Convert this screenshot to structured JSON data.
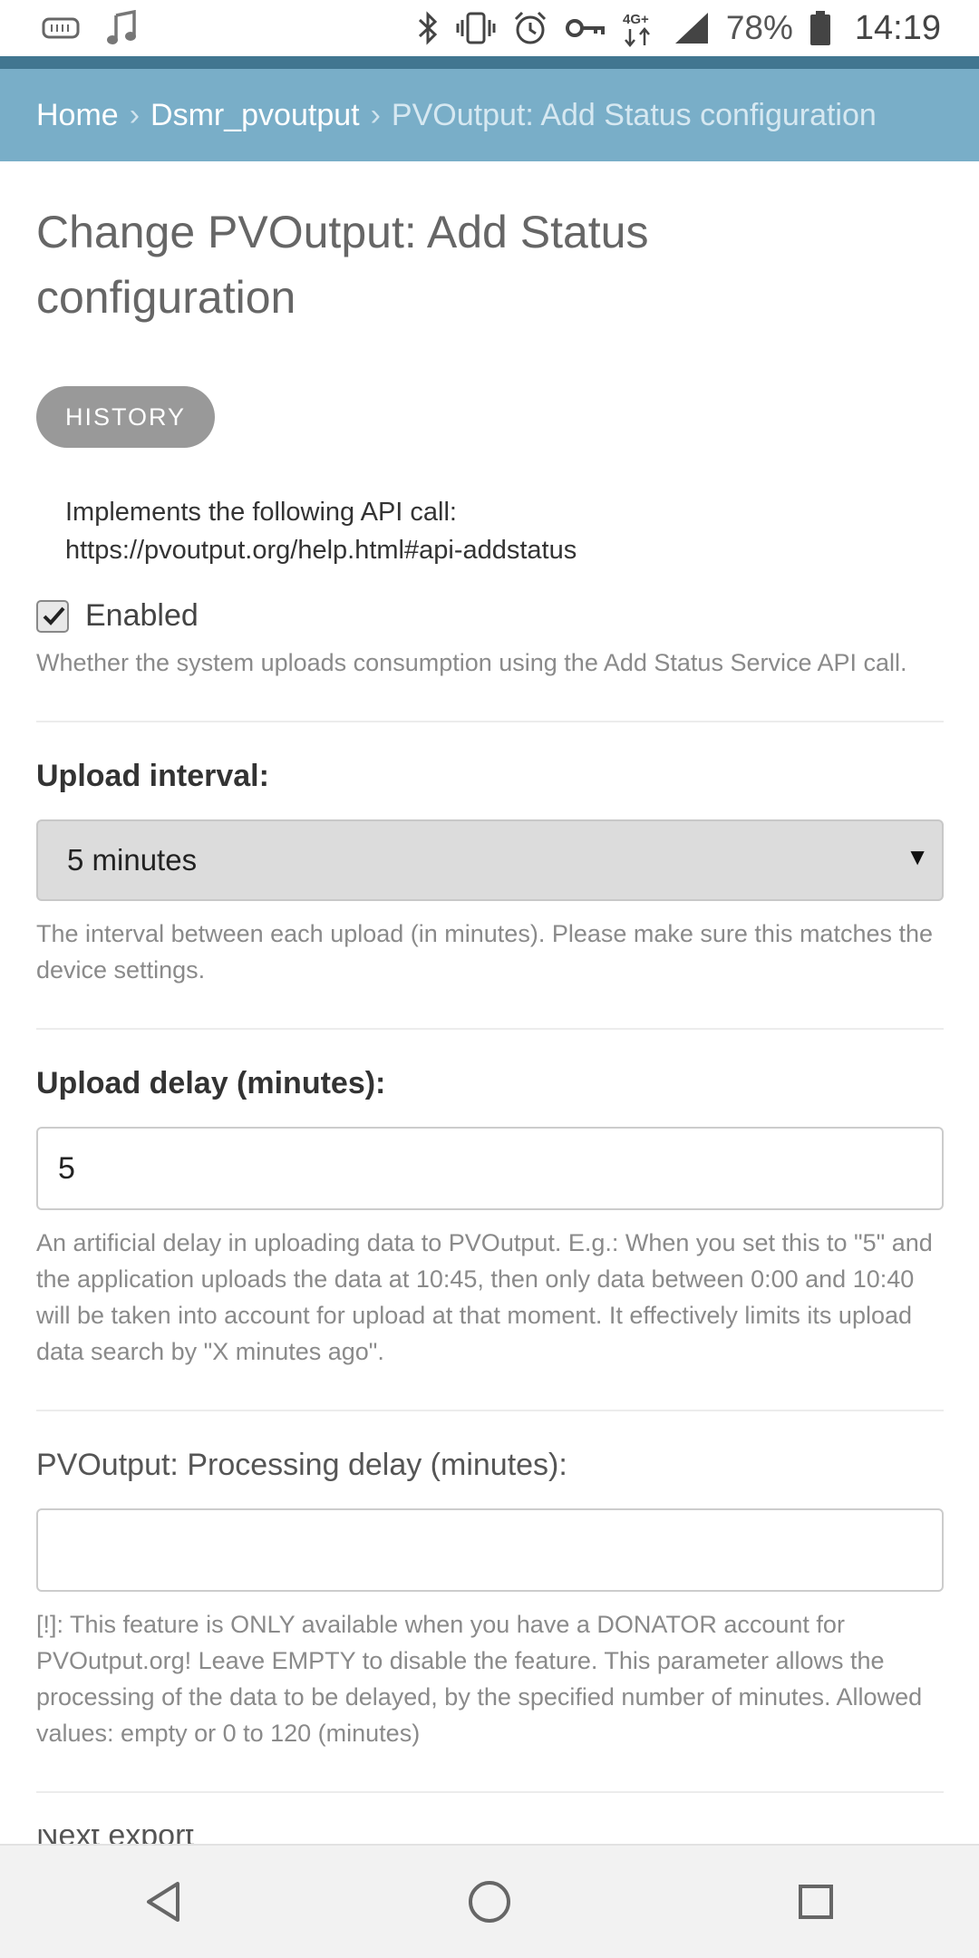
{
  "status_bar": {
    "time": "14:19",
    "battery_percent": "78%",
    "network": "4G+",
    "icons": [
      "sd-card-icon",
      "music-note-icon",
      "bluetooth-icon",
      "vibrate-icon",
      "alarm-icon",
      "key-icon",
      "network-icon",
      "signal-icon",
      "battery-icon"
    ]
  },
  "breadcrumbs": {
    "home": "Home",
    "separator": "›",
    "app": "Dsmr_pvoutput",
    "current": "PVOutput: Add Status configuration"
  },
  "page": {
    "title": "Change PVOutput: Add Status configuration",
    "history_button": "HISTORY",
    "description_line1": "Implements the following API call:",
    "description_line2": "https://pvoutput.org/help.html#api-addstatus"
  },
  "fields": {
    "enabled": {
      "label": "Enabled",
      "checked": true,
      "help": "Whether the system uploads consumption using the Add Status Service API call."
    },
    "upload_interval": {
      "label": "Upload interval:",
      "value": "5 minutes",
      "arrow": "▼",
      "help": "The interval between each upload (in minutes). Please make sure this matches the device settings."
    },
    "upload_delay": {
      "label": "Upload delay (minutes):",
      "value": "5",
      "help": "An artificial delay in uploading data to PVOutput. E.g.: When you set this to \"5\" and the application uploads the data at 10:45, then only data between 0:00 and 10:40 will be taken into account for upload at that moment. It effectively limits its upload data search by \"X minutes ago\"."
    },
    "processing_delay": {
      "label": "PVOutput: Processing delay (minutes):",
      "value": "",
      "help": "[!]: This feature is ONLY available when you have a DONATOR account for PVOutput.org! Leave EMPTY to disable the feature. This parameter allows the processing of the data to be delayed, by the specified number of minutes. Allowed values: empty or 0 to 120 (minutes)"
    },
    "next_field_label": "Next export"
  },
  "colors": {
    "header_dark": "#417690",
    "breadcrumb_bg": "#79aec8",
    "history_button_bg": "#999999",
    "select_bg": "#dcdcdc"
  }
}
